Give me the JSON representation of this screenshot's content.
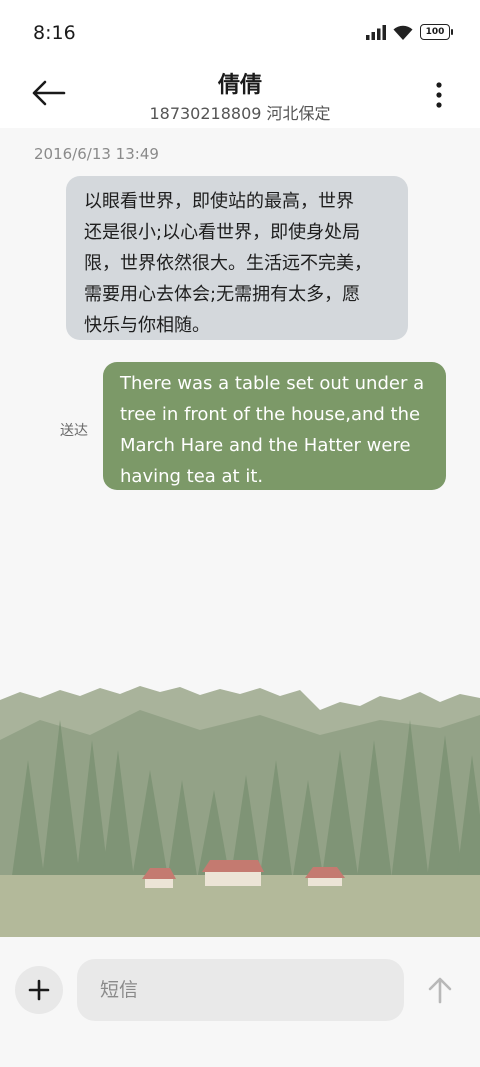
{
  "status_bar": {
    "time": "8:16",
    "battery": "100",
    "icons": [
      "signal-icon",
      "wifi-icon",
      "battery-icon"
    ]
  },
  "header": {
    "contact_name": "倩倩",
    "contact_subtitle": "18730218809 河北保定",
    "back_icon": "arrow-left-icon",
    "more_icon": "more-vertical-icon"
  },
  "conversation": {
    "timestamp": "2016/6/13 13:49",
    "incoming_message": {
      "lines": [
        "以眼看世界，即使站的最高，世界",
        "还是很小;以心看世界，即使身处局",
        "限，世界依然很大。生活远不完美，",
        "需要用心去体会;无需拥有太多，愿",
        "快乐与你相随。"
      ]
    },
    "outgoing_message": {
      "lines": [
        "There was a table set out under a",
        "tree in front of the house,and the",
        "March Hare and the Hatter were",
        "having tea at it."
      ],
      "status": "送达"
    }
  },
  "composer": {
    "placeholder": "短信",
    "add_icon": "plus-icon",
    "send_icon": "arrow-up-icon"
  },
  "colors": {
    "incoming_bubble": "#d4d8dc",
    "outgoing_bubble": "#7c9968",
    "background": "#f7f7f7"
  }
}
